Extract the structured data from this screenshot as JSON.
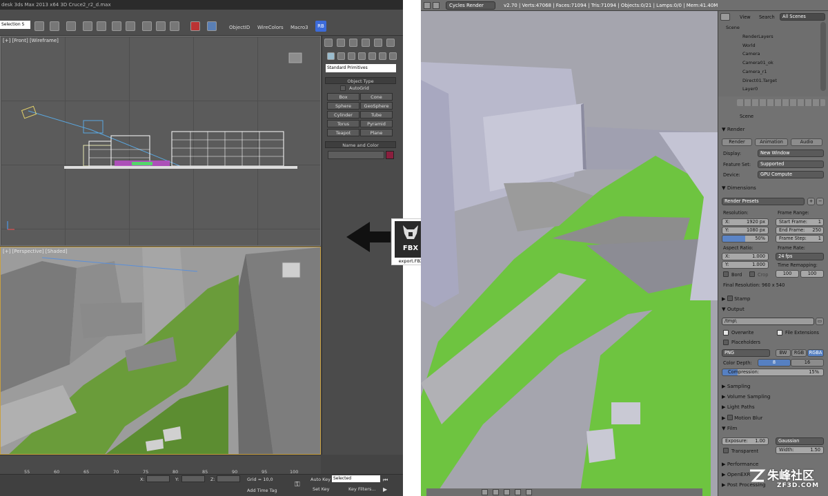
{
  "max": {
    "window_title": "desk 3ds Max 2013 x64     3D Cruce2_r2_d.max",
    "selection_set": "Selection S",
    "toolbar": {
      "objectid": "ObjectID",
      "wirecolors": "WireColors",
      "macro3": "Macro3",
      "rb": "RB"
    },
    "viewport_front_label": "[+] [Front] [Wireframe]",
    "viewport_persp_label": "[+] [Perspective] [Shaded]",
    "primitives_dropdown": "Standard Primitives",
    "object_type_header": "Object Type",
    "autogrid": "AutoGrid",
    "object_buttons": [
      "Box",
      "Cone",
      "Sphere",
      "GeoSphere",
      "Cylinder",
      "Tube",
      "Torus",
      "Pyramid",
      "Teapot",
      "Plane"
    ],
    "name_color_header": "Name and Color",
    "timeline_ticks": [
      "55",
      "60",
      "65",
      "70",
      "75",
      "80",
      "85",
      "90",
      "95",
      "100"
    ],
    "status": {
      "x_label": "X:",
      "y_label": "Y:",
      "z_label": "Z:",
      "grid": "Grid = 10,0",
      "auto_key": "Auto Key",
      "selected": "Selected",
      "set_key": "Set Key",
      "key_filters": "Key Filters...",
      "add_time_tag": "Add Time Tag"
    }
  },
  "fbx": {
    "badge": "FBX",
    "filename": "export.FBX"
  },
  "blender": {
    "engine": "Cycles Render",
    "stats": "v2.70 | Verts:47068 | Faces:71094 | Tris:71094 | Objects:0/21 | Lamps:0/0 | Mem:41.40M",
    "outliner_tabs": [
      "View",
      "Search",
      "All Scenes"
    ],
    "outliner_items": [
      "Scene",
      "RenderLayers",
      "World",
      "Camera",
      "Camera01_ok",
      "Camera_r1",
      "Direct01.Target",
      "Layer0"
    ],
    "scene_label": "Scene",
    "render": {
      "header": "Render",
      "buttons": [
        "Render",
        "Animation",
        "Audio"
      ],
      "display_label": "Display:",
      "display": "New Window",
      "feature_label": "Feature Set:",
      "feature": "Supported",
      "device_label": "Device:",
      "device": "GPU Compute"
    },
    "dimensions": {
      "header": "Dimensions",
      "presets": "Render Presets",
      "resolution_label": "Resolution:",
      "res_x": "X:",
      "res_x_val": "1920 px",
      "res_y": "Y:",
      "res_y_val": "1080 px",
      "res_pct": "50%",
      "frame_range_label": "Frame Range:",
      "start_frame": "Start Frame:",
      "start_frame_val": "1",
      "end_frame": "End Frame:",
      "end_frame_val": "250",
      "frame_step": "Frame Step:",
      "frame_step_val": "1",
      "aspect_label": "Aspect Ratio:",
      "asp_x": "X:",
      "asp_x_val": "1.000",
      "asp_y": "Y:",
      "asp_y_val": "1.000",
      "frame_rate_label": "Frame Rate:",
      "frame_rate": "24 fps",
      "time_remap_label": "Time Remapping:",
      "remap_old": "100",
      "remap_new": "100",
      "bord": "Bord",
      "crop": "Crop",
      "final_resolution": "Final Resolution: 960 x 540"
    },
    "stamp": "Stamp",
    "output": {
      "header": "Output",
      "path": "/tmp\\",
      "overwrite": "Overwrite",
      "file_extensions": "File Extensions",
      "placeholders": "Placeholders",
      "format": "PNG",
      "bw": "BW",
      "rgb": "RGB",
      "rgba": "RGBA",
      "color_depth_label": "Color Depth:",
      "depth8": "8",
      "depth16": "16",
      "compression": "Compression:",
      "compression_val": "15%"
    },
    "sections": [
      "Sampling",
      "Volume Sampling",
      "Light Paths",
      "Motion Blur"
    ],
    "film": {
      "header": "Film",
      "exposure": "Exposure:",
      "exposure_val": "1.00",
      "filter": "Gaussian",
      "transparent": "Transparent",
      "width": "Width:",
      "width_val": "1.50"
    },
    "bottom_sections": [
      "Performance",
      "OpenEXR",
      "Post Processing"
    ]
  },
  "watermark": {
    "text": "朱峰社区",
    "url": "ZF3D.COM"
  },
  "colors": {
    "blender_green": "#6ec440",
    "max_blue_selected": "#5680c2",
    "swatch": "#8a1f3e"
  }
}
